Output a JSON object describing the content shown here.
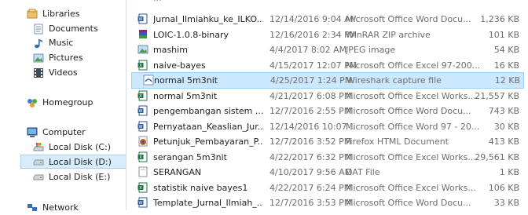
{
  "nav": {
    "libraries": "Libraries",
    "documents": "Documents",
    "music": "Music",
    "pictures": "Pictures",
    "videos": "Videos",
    "homegroup": "Homegroup",
    "computer": "Computer",
    "disk_c": "Local Disk (C:)",
    "disk_d": "Local Disk (D:)",
    "disk_e": "Local Disk (E:)",
    "network": "Network"
  },
  "files": [
    {
      "name": "Jurnal_Ilmiahku_ke_ILKO...",
      "date": "12/14/2016 9:04 AM",
      "type": "Microsoft Office Word Docu...",
      "size": "1,236 KB",
      "icon": "word-icon"
    },
    {
      "name": "LOIC-1.0.8-binary",
      "date": "12/16/2016 2:34 PM",
      "type": "WinRAR ZIP archive",
      "size": "101 KB",
      "icon": "winrar-icon"
    },
    {
      "name": "mashim",
      "date": "4/4/2017 8:02 AM",
      "type": "JPEG image",
      "size": "54 KB",
      "icon": "jpeg-icon"
    },
    {
      "name": "naive-bayes",
      "date": "4/15/2017 12:07 PM",
      "type": "Microsoft Office Excel 97-200...",
      "size": "16 KB",
      "icon": "excel-icon"
    },
    {
      "name": "normal 5m3nit",
      "date": "4/25/2017 1:24 PM",
      "type": "Wireshark capture file",
      "size": "12 KB",
      "icon": "wireshark-icon"
    },
    {
      "name": "normal 5m3nit",
      "date": "4/21/2017 6:08 PM",
      "type": "Microsoft Office Excel Works...",
      "size": "21,557 KB",
      "icon": "excel-icon"
    },
    {
      "name": "pengembangan sistem ...",
      "date": "12/7/2016 2:55 PM",
      "type": "Microsoft Office Word Docu...",
      "size": "743 KB",
      "icon": "word-icon"
    },
    {
      "name": "Pernyataan_Keaslian_Jur...",
      "date": "12/14/2016 10:07 ...",
      "type": "Microsoft Office Word 97 - 20...",
      "size": "30 KB",
      "icon": "word-icon"
    },
    {
      "name": "Petunjuk_Pembayaran_P...",
      "date": "12/7/2016 3:52 PM",
      "type": "Firefox HTML Document",
      "size": "413 KB",
      "icon": "firefox-html-icon"
    },
    {
      "name": "serangan 5m3nit",
      "date": "4/22/2017 6:32 PM",
      "type": "Microsoft Office Excel Works...",
      "size": "29,561 KB",
      "icon": "excel-icon"
    },
    {
      "name": "SERANGAN",
      "date": "4/10/2017 9:56 AM",
      "type": "DAT File",
      "size": "1 KB",
      "icon": "dat-file-icon"
    },
    {
      "name": "statistik naive bayes1",
      "date": "4/22/2017 6:24 PM",
      "type": "Microsoft Office Excel Works...",
      "size": "106 KB",
      "icon": "excel-icon"
    },
    {
      "name": "Template_Jurnal_Ilmiah_...",
      "date": "12/7/2016 3:53 PM",
      "type": "Microsoft Office Word Docu...",
      "size": "33 KB",
      "icon": "word-icon"
    }
  ],
  "colors": {
    "selection_fill": "#cce8ff",
    "selection_border": "#99d1ff",
    "nav_selection_fill": "#d9ecfb",
    "secondary_text": "#6d6d6d"
  }
}
